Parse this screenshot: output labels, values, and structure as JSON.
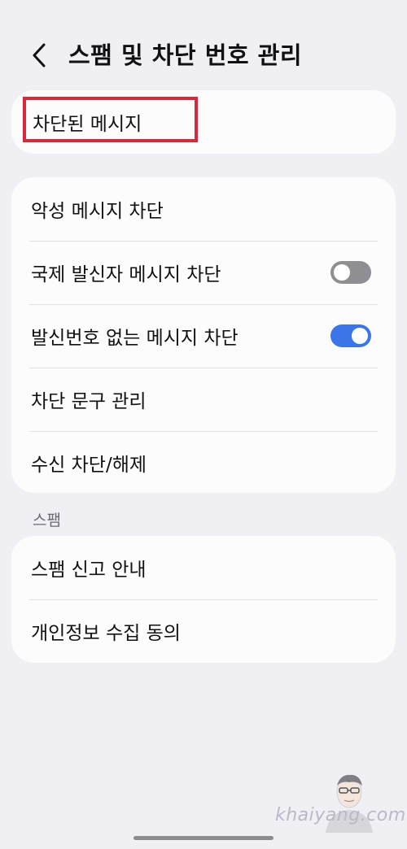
{
  "header": {
    "title": "스팸 및 차단 번호 관리",
    "back_icon": "chevron-left-icon"
  },
  "blocked_messages": {
    "label": "차단된 메시지",
    "highlight_color": "#d8283a"
  },
  "settings": {
    "malicious": {
      "label": "악성 메시지 차단"
    },
    "international": {
      "label": "국제 발신자 메시지 차단",
      "enabled": false
    },
    "no_caller_id": {
      "label": "발신번호 없는 메시지 차단",
      "enabled": true
    },
    "phrases": {
      "label": "차단 문구 관리"
    },
    "block_unblock": {
      "label": "수신 차단/해제"
    }
  },
  "spam_section": {
    "header": "스팸",
    "report_guide": {
      "label": "스팸 신고 안내"
    },
    "privacy_consent": {
      "label": "개인정보 수집 동의"
    }
  },
  "watermark": {
    "text": "khaiyang.com"
  },
  "colors": {
    "background": "#f0eff4",
    "card": "#fcfcfd",
    "toggle_on": "#3b76e8",
    "toggle_off": "#8e8e93"
  }
}
